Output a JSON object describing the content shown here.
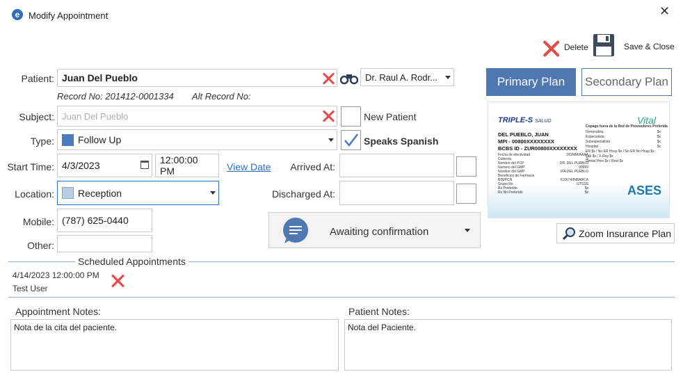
{
  "window": {
    "title": "Modify Appointment"
  },
  "toolbar": {
    "delete_label": "Delete",
    "save_close_label": "Save & Close"
  },
  "patient": {
    "label": "Patient:",
    "value": "Juan Del Pueblo",
    "record_no": "Record No: 201412-0001334",
    "alt_record": "Alt Record No:"
  },
  "doctor": {
    "value": "Dr. Raul A. Rodr..."
  },
  "subject": {
    "label": "Subject:",
    "placeholder": "Juan Del Pueblo"
  },
  "new_patient": {
    "label": "New Patient",
    "checked": false
  },
  "type": {
    "label": "Type:",
    "value": "Follow Up",
    "color": "#4a7bbd"
  },
  "speaks_spanish": {
    "label": "Speaks Spanish",
    "checked": true
  },
  "start_time": {
    "label": "Start Time:",
    "date": "4/3/2023",
    "time": "12:00:00 PM",
    "view_date_link": "View Date"
  },
  "arrived_at": {
    "label": "Arrived At:",
    "value": ""
  },
  "location": {
    "label": "Location:",
    "value": "Reception",
    "color": "#b7cde3"
  },
  "discharged_at": {
    "label": "Discharged At:",
    "value": ""
  },
  "mobile": {
    "label": "Mobile:",
    "value": "(787) 625-0440"
  },
  "other": {
    "label": "Other:",
    "value": ""
  },
  "status": {
    "value": "Awaiting confirmation"
  },
  "plans": {
    "primary": "Primary Plan",
    "secondary": "Secondary Plan",
    "active_color": "#4f78b0"
  },
  "insurance_card": {
    "carrier": "TRIPLE-S",
    "carrier_sub": "SALUD",
    "brand": "Vital",
    "agency": "ASES",
    "member_name": "DEL PUEBLO, JUAN",
    "mpi": "MPI - 00800XXXXXXXX",
    "bcbs_id": "BCBS ID - ZUR00800XXXXXXXX",
    "left_rows": [
      [
        "Fecha de efectividad",
        "DD/MM/AAAA"
      ],
      [
        "Cubierta",
        "S"
      ],
      [
        "Nombre del PCP",
        "DR. DEL PUEBLO"
      ],
      [
        "Numero del GMP",
        "00999"
      ],
      [
        "Nombre del GMP",
        "IPA DEL PUEBLO"
      ],
      [
        "Beneficios de Farmacia",
        ""
      ],
      [
        "BIN/PCN",
        "610674/INBARCA"
      ],
      [
        "Grupo Rx",
        "GTSSS"
      ],
      [
        "Rx Preferido",
        "$x"
      ],
      [
        "Rx No Preferido",
        "$x"
      ]
    ],
    "right_title": "Copago fuera de la Red de Proveedores Preferida",
    "right_rows": [
      [
        "Generalista",
        "$x"
      ],
      [
        "Especialista",
        "$x"
      ],
      [
        "Subespecialista",
        "$x"
      ],
      [
        "Hospital",
        "$x"
      ],
      [
        "ER $x / No ER Hosp $x / No ER No Hosp $x",
        ""
      ],
      [
        "Lab $x / X-Ray $x",
        ""
      ],
      [
        "Dental Prev $x / Rest $x",
        ""
      ]
    ]
  },
  "zoom_button": {
    "label": "Zoom Insurance Plan"
  },
  "scheduled": {
    "title": "Scheduled Appointments",
    "items": [
      {
        "datetime": "4/14/2023 12:00:00 PM",
        "user": "Test User"
      }
    ]
  },
  "appointment_notes": {
    "label": "Appointment Notes:",
    "value": "Nota de la cita del paciente."
  },
  "patient_notes": {
    "label": "Patient Notes:",
    "value": "Nota del Paciente."
  }
}
